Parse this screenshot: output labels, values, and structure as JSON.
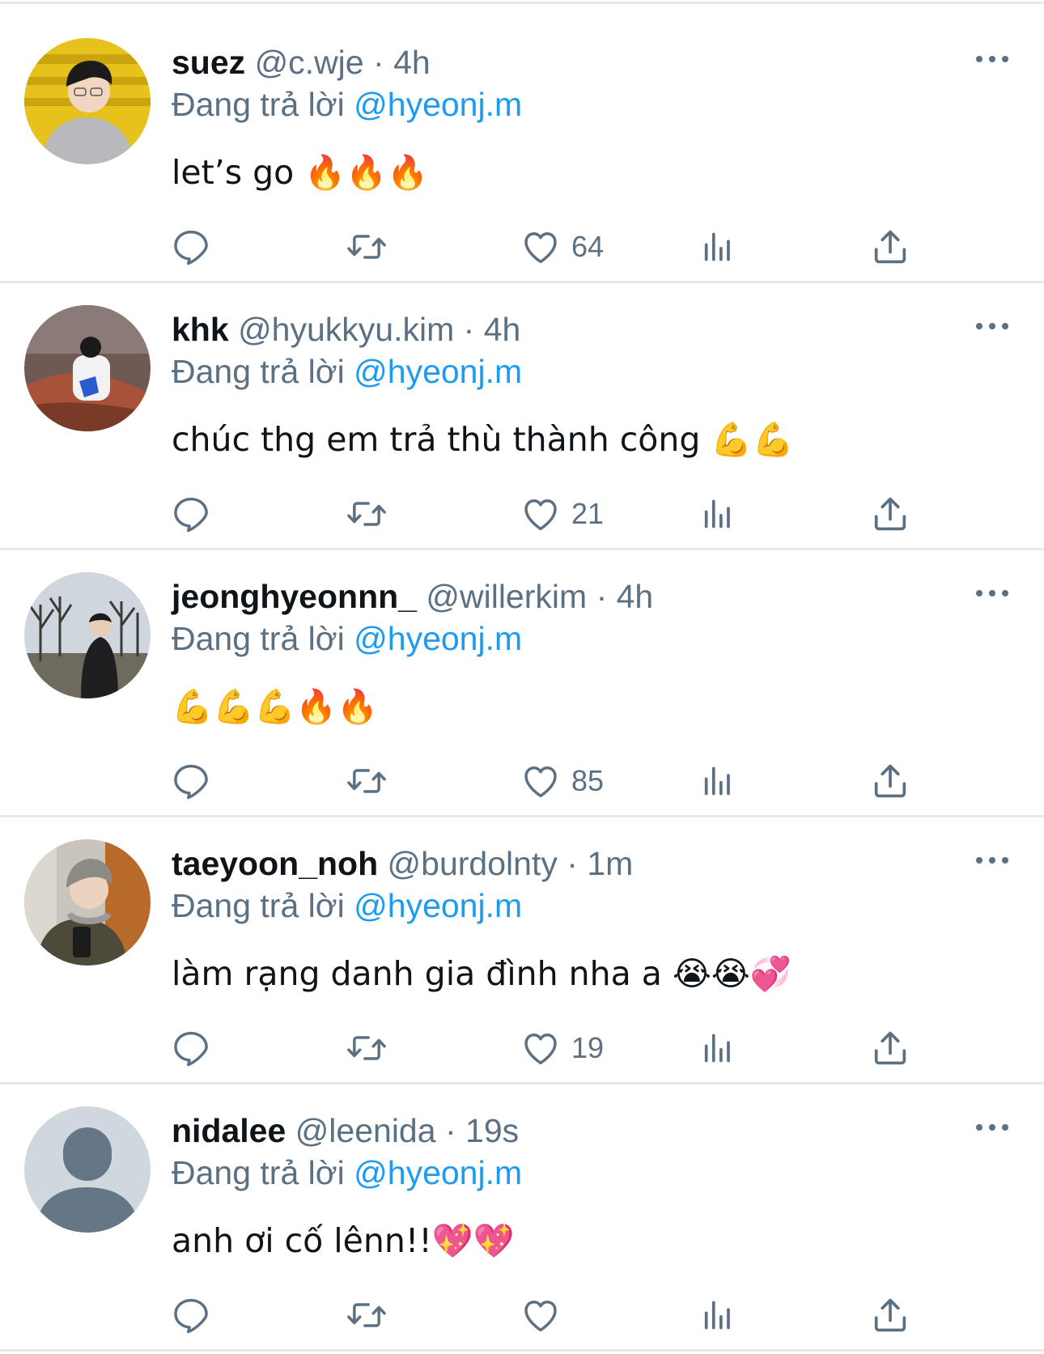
{
  "reply_prefix": "Đang trả lời",
  "colors": {
    "accent": "#1d9bf0",
    "secondary_text": "#5b7083",
    "divider": "#e6e8ea"
  },
  "tweets": [
    {
      "display_name": "suez",
      "handle": "@c.wje",
      "time": "4h",
      "reply_to": "@hyeonj.m",
      "text": "let’s go 🔥🔥🔥",
      "like_count": "64",
      "avatar": "photo-yellow-stadium-seats"
    },
    {
      "display_name": "khk",
      "handle": "@hyukkyu.kim",
      "time": "4h",
      "reply_to": "@hyeonj.m",
      "text": "chúc thg em trả thù thành công 💪💪",
      "like_count": "21",
      "avatar": "photo-red-rocks"
    },
    {
      "display_name": "jeonghyeonnn_",
      "handle": "@willerkim",
      "time": "4h",
      "reply_to": "@hyeonj.m",
      "text": "💪💪💪🔥🔥",
      "like_count": "85",
      "avatar": "photo-bare-trees"
    },
    {
      "display_name": "taeyoon_noh",
      "handle": "@burdolnty",
      "time": "1m",
      "reply_to": "@hyeonj.m",
      "text": "làm rạng danh gia đình nha a 😭😭💞",
      "like_count": "19",
      "avatar": "photo-mirror-selfie"
    },
    {
      "display_name": "nidalee",
      "handle": "@leenida",
      "time": "19s",
      "reply_to": "@hyeonj.m",
      "text": "anh ơi cố lênn!!💖💖",
      "like_count": "",
      "avatar": "default-profile-placeholder"
    }
  ]
}
